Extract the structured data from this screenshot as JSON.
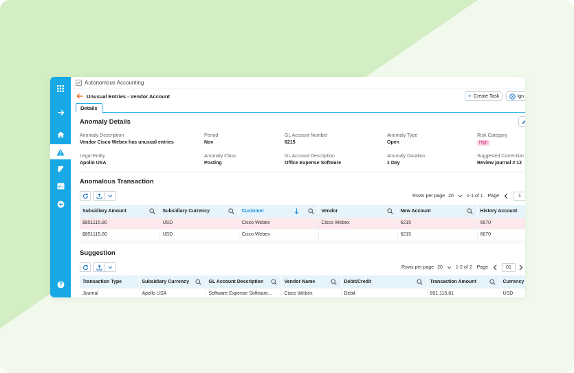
{
  "app": {
    "title": "Autonomous Accounting"
  },
  "header": {
    "breadcrumb": "Unusual Entries - Vendor Account",
    "create_task": "Create Task",
    "ignore": "Ign"
  },
  "tabs": [
    {
      "label": "Details"
    }
  ],
  "anomaly": {
    "title": "Anomaly Details",
    "fields": {
      "description": {
        "label": "Anomaly Description",
        "value": "Vendor Cisco Webex has unusual entries"
      },
      "period": {
        "label": "Period",
        "value": "Nov"
      },
      "gl_number": {
        "label": "GL Account Number",
        "value": "6215"
      },
      "type": {
        "label": "Anomaly Type",
        "value": "Open"
      },
      "risk": {
        "label": "Risk Category",
        "value": "High"
      },
      "legal_entity": {
        "label": "Legal Entity",
        "value": "Apollo USA"
      },
      "class": {
        "label": "Anomaly Class",
        "value": "Posting"
      },
      "gl_description": {
        "label": "GL Account Description",
        "value": "Office Expense Software"
      },
      "duration": {
        "label": "Anomaly Duration",
        "value": "1 Day"
      },
      "correction": {
        "label": "Suggested Correction",
        "value": "Review journal # 12"
      }
    }
  },
  "transactions": {
    "title": "Anomalous Transaction",
    "pager": {
      "rows_label": "Rows per page",
      "rows_value": "20",
      "range": "1-1 of 1",
      "page_label": "Page",
      "page_value": "1"
    },
    "columns": [
      "Subsidiary Amount",
      "Subsidiary Currency",
      "Customer",
      "Vendor",
      "New Account",
      "History Account"
    ],
    "rows": [
      [
        "$851115.80",
        "USD",
        "Cisco Webex",
        "Cisco Webex",
        "6215",
        "6670"
      ],
      [
        "$851115.80",
        "USD",
        "Cisco Webex",
        "",
        "6215",
        "6670"
      ]
    ]
  },
  "suggestion": {
    "title": "Suggestion",
    "pager": {
      "rows_label": "Rows per page",
      "rows_value": "20",
      "range": "1-2 of 2",
      "page_label": "Page",
      "page_value": "01"
    },
    "columns": [
      "Transaction Type",
      "Subsidiary Currency",
      "GL Account Description",
      "Vendor Name",
      "Debit/Credit",
      "Transaction Amount",
      "Currency"
    ],
    "rows": [
      [
        "Journal",
        "Apollo USA",
        "Software Expense Software...",
        "Cisco Webex",
        "Debit",
        "851,115,81",
        "USD"
      ]
    ]
  },
  "colors": {
    "rail": "#19a8e6",
    "accent": "#1a73c9",
    "header_bg": "#e5f3fb",
    "highlight_row": "#fde8ec",
    "badge_bg": "#fbd3e4",
    "badge_text": "#c2185b"
  },
  "icons": {
    "rail": [
      "apps-grid-icon",
      "arrow-right-icon",
      "home-icon",
      "warning-icon",
      "book-icon",
      "checklist-icon",
      "add-circle-icon",
      "help-icon"
    ]
  }
}
